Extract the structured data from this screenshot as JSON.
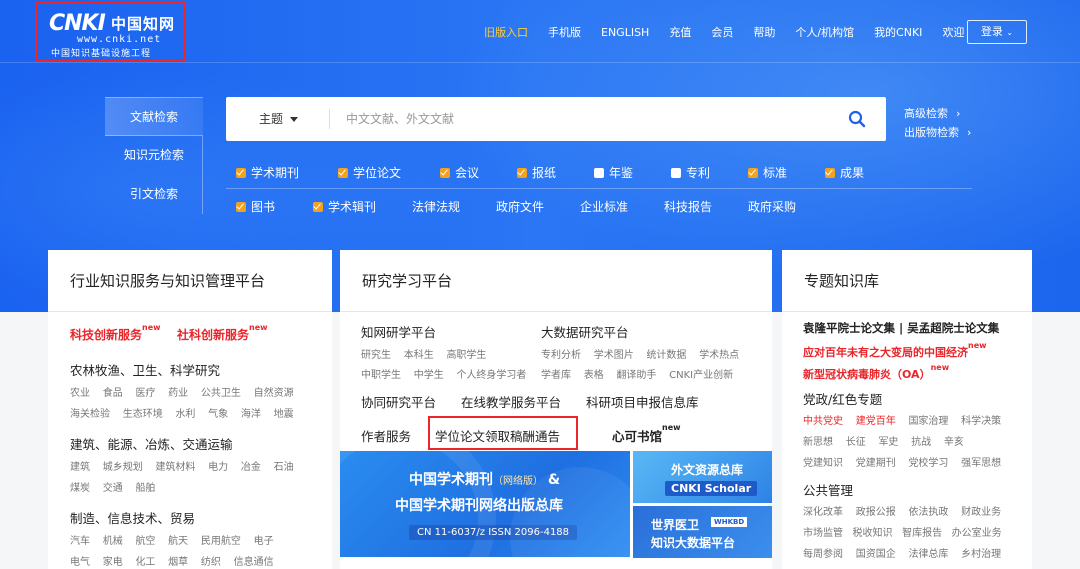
{
  "logo": {
    "mark": "CNKI",
    "mark_cn": "中国知网",
    "url": "www.cnki.net",
    "sub": "中国知识基础设施工程"
  },
  "topnav": [
    "旧版入口",
    "手机版",
    "ENGLISH",
    "充值",
    "会员",
    "帮助",
    "个人/机构馆",
    "我的CNKI",
    "欢迎"
  ],
  "login": "登录",
  "search_tabs": [
    "文献检索",
    "知识元检索",
    "引文检索"
  ],
  "search": {
    "field": "主题",
    "placeholder": "中文文献、外文文献"
  },
  "advanced": [
    "高级检索",
    "出版物检索"
  ],
  "filters_row1": [
    {
      "label": "学术期刊",
      "checked": true
    },
    {
      "label": "学位论文",
      "checked": true
    },
    {
      "label": "会议",
      "checked": true
    },
    {
      "label": "报纸",
      "checked": true
    },
    {
      "label": "年鉴",
      "checked": false
    },
    {
      "label": "专利",
      "checked": false
    },
    {
      "label": "标准",
      "checked": true
    },
    {
      "label": "成果",
      "checked": true
    }
  ],
  "filters_row2": [
    {
      "label": "图书",
      "checked": true
    },
    {
      "label": "学术辑刊",
      "checked": true
    },
    {
      "label": "法律法规"
    },
    {
      "label": "政府文件"
    },
    {
      "label": "企业标准"
    },
    {
      "label": "科技报告"
    },
    {
      "label": "政府采购"
    }
  ],
  "panel1": {
    "title": "行业知识服务与知识管理平台",
    "links_red": [
      "科技创新服务",
      "社科创新服务"
    ],
    "new": "new",
    "groups": [
      {
        "title": "农林牧渔、卫生、科学研究",
        "rows": [
          [
            "农业",
            "食品",
            "医疗",
            "药业",
            "公共卫生",
            "自然资源"
          ],
          [
            "海关检验",
            "生态环境",
            "水利",
            "气象",
            "海洋",
            "地震"
          ]
        ]
      },
      {
        "title": "建筑、能源、冶炼、交通运输",
        "rows": [
          [
            "建筑",
            "城乡规划",
            "建筑材料",
            "电力",
            "冶金",
            "石油"
          ],
          [
            "煤炭",
            "交通",
            "船舶"
          ]
        ]
      },
      {
        "title": "制造、信息技术、贸易",
        "rows": [
          [
            "汽车",
            "机械",
            "航空",
            "航天",
            "民用航空",
            "电子"
          ],
          [
            "电气",
            "家电",
            "化工",
            "烟草",
            "纺织",
            "信息通信"
          ]
        ]
      }
    ]
  },
  "panel2": {
    "title": "研究学习平台",
    "col1_title": "知网研学平台",
    "col1_rows": [
      [
        "研究生",
        "本科生",
        "高职学生"
      ],
      [
        "中职学生",
        "中学生",
        "个人终身学习者"
      ]
    ],
    "col2_title": "大数据研究平台",
    "col2_rows": [
      [
        "专利分析",
        "学术图片",
        "统计数据",
        "学术热点"
      ],
      [
        "学者库",
        "表格",
        "翻译助手",
        "CNKI产业创新"
      ]
    ],
    "row3": [
      "协同研究平台",
      "在线教学服务平台",
      "科研项目申报信息库"
    ],
    "row4": [
      "作者服务",
      "学位论文领取稿酬通告",
      "心可书馆"
    ],
    "new": "new",
    "banner": {
      "t1": "中国学术期刊",
      "t1_small": "（网络版）",
      "amp": "&",
      "t2": "中国学术期刊网络出版总库",
      "t3": "CN 11-6037/z    ISSN 2096-4188",
      "r1a": "外文资源总库",
      "r1b": "CNKI Scholar",
      "r2a": "世界医卫",
      "r2tag": "WHKBD",
      "r2b": "知识大数据平台"
    }
  },
  "panel3": {
    "title": "专题知识库",
    "line1": "袁隆平院士论文集 | 吴孟超院士论文集",
    "line2": "应对百年未有之大变局的中国经济",
    "line3": "新型冠状病毒肺炎（OA）",
    "new": "new",
    "g1_title": "党政/红色专题",
    "g1_rows": [
      [
        "中共党史",
        "建党百年",
        "国家治理",
        "科学决策"
      ],
      [
        "新思想",
        "长征",
        "军史",
        "抗战",
        "辛亥"
      ],
      [
        "党建知识",
        "党建期刊",
        "党校学习",
        "强军思想"
      ]
    ],
    "g2_title": "公共管理",
    "g2_rows": [
      [
        "深化改革",
        "政报公报",
        "依法执政",
        "财政业务"
      ],
      [
        "市场监管",
        "税收知识",
        "智库报告",
        "办公室业务"
      ],
      [
        "每周参阅",
        "国资国企",
        "法律总库",
        "乡村治理"
      ]
    ]
  }
}
